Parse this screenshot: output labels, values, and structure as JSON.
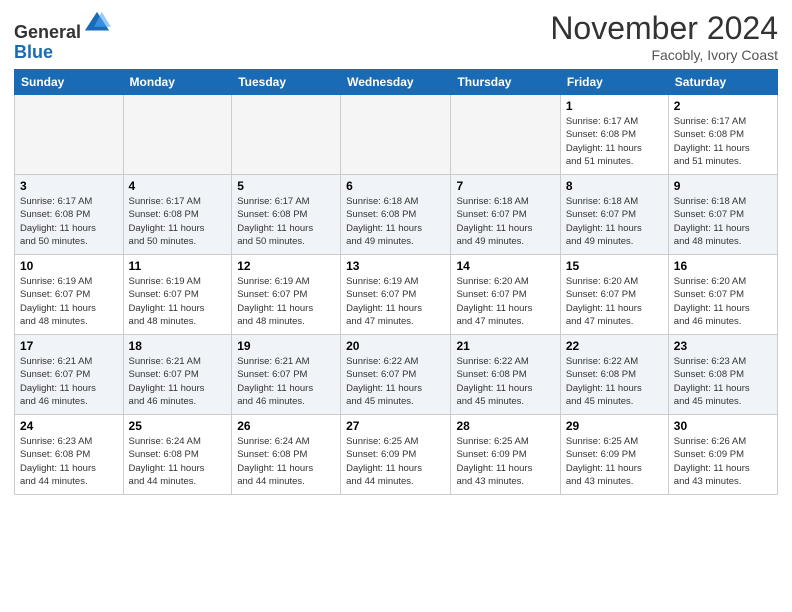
{
  "logo": {
    "general": "General",
    "blue": "Blue"
  },
  "header": {
    "month": "November 2024",
    "location": "Facobly, Ivory Coast"
  },
  "days_of_week": [
    "Sunday",
    "Monday",
    "Tuesday",
    "Wednesday",
    "Thursday",
    "Friday",
    "Saturday"
  ],
  "weeks": [
    [
      {
        "day": "",
        "info": ""
      },
      {
        "day": "",
        "info": ""
      },
      {
        "day": "",
        "info": ""
      },
      {
        "day": "",
        "info": ""
      },
      {
        "day": "",
        "info": ""
      },
      {
        "day": "1",
        "info": "Sunrise: 6:17 AM\nSunset: 6:08 PM\nDaylight: 11 hours\nand 51 minutes."
      },
      {
        "day": "2",
        "info": "Sunrise: 6:17 AM\nSunset: 6:08 PM\nDaylight: 11 hours\nand 51 minutes."
      }
    ],
    [
      {
        "day": "3",
        "info": "Sunrise: 6:17 AM\nSunset: 6:08 PM\nDaylight: 11 hours\nand 50 minutes."
      },
      {
        "day": "4",
        "info": "Sunrise: 6:17 AM\nSunset: 6:08 PM\nDaylight: 11 hours\nand 50 minutes."
      },
      {
        "day": "5",
        "info": "Sunrise: 6:17 AM\nSunset: 6:08 PM\nDaylight: 11 hours\nand 50 minutes."
      },
      {
        "day": "6",
        "info": "Sunrise: 6:18 AM\nSunset: 6:08 PM\nDaylight: 11 hours\nand 49 minutes."
      },
      {
        "day": "7",
        "info": "Sunrise: 6:18 AM\nSunset: 6:07 PM\nDaylight: 11 hours\nand 49 minutes."
      },
      {
        "day": "8",
        "info": "Sunrise: 6:18 AM\nSunset: 6:07 PM\nDaylight: 11 hours\nand 49 minutes."
      },
      {
        "day": "9",
        "info": "Sunrise: 6:18 AM\nSunset: 6:07 PM\nDaylight: 11 hours\nand 48 minutes."
      }
    ],
    [
      {
        "day": "10",
        "info": "Sunrise: 6:19 AM\nSunset: 6:07 PM\nDaylight: 11 hours\nand 48 minutes."
      },
      {
        "day": "11",
        "info": "Sunrise: 6:19 AM\nSunset: 6:07 PM\nDaylight: 11 hours\nand 48 minutes."
      },
      {
        "day": "12",
        "info": "Sunrise: 6:19 AM\nSunset: 6:07 PM\nDaylight: 11 hours\nand 48 minutes."
      },
      {
        "day": "13",
        "info": "Sunrise: 6:19 AM\nSunset: 6:07 PM\nDaylight: 11 hours\nand 47 minutes."
      },
      {
        "day": "14",
        "info": "Sunrise: 6:20 AM\nSunset: 6:07 PM\nDaylight: 11 hours\nand 47 minutes."
      },
      {
        "day": "15",
        "info": "Sunrise: 6:20 AM\nSunset: 6:07 PM\nDaylight: 11 hours\nand 47 minutes."
      },
      {
        "day": "16",
        "info": "Sunrise: 6:20 AM\nSunset: 6:07 PM\nDaylight: 11 hours\nand 46 minutes."
      }
    ],
    [
      {
        "day": "17",
        "info": "Sunrise: 6:21 AM\nSunset: 6:07 PM\nDaylight: 11 hours\nand 46 minutes."
      },
      {
        "day": "18",
        "info": "Sunrise: 6:21 AM\nSunset: 6:07 PM\nDaylight: 11 hours\nand 46 minutes."
      },
      {
        "day": "19",
        "info": "Sunrise: 6:21 AM\nSunset: 6:07 PM\nDaylight: 11 hours\nand 46 minutes."
      },
      {
        "day": "20",
        "info": "Sunrise: 6:22 AM\nSunset: 6:07 PM\nDaylight: 11 hours\nand 45 minutes."
      },
      {
        "day": "21",
        "info": "Sunrise: 6:22 AM\nSunset: 6:08 PM\nDaylight: 11 hours\nand 45 minutes."
      },
      {
        "day": "22",
        "info": "Sunrise: 6:22 AM\nSunset: 6:08 PM\nDaylight: 11 hours\nand 45 minutes."
      },
      {
        "day": "23",
        "info": "Sunrise: 6:23 AM\nSunset: 6:08 PM\nDaylight: 11 hours\nand 45 minutes."
      }
    ],
    [
      {
        "day": "24",
        "info": "Sunrise: 6:23 AM\nSunset: 6:08 PM\nDaylight: 11 hours\nand 44 minutes."
      },
      {
        "day": "25",
        "info": "Sunrise: 6:24 AM\nSunset: 6:08 PM\nDaylight: 11 hours\nand 44 minutes."
      },
      {
        "day": "26",
        "info": "Sunrise: 6:24 AM\nSunset: 6:08 PM\nDaylight: 11 hours\nand 44 minutes."
      },
      {
        "day": "27",
        "info": "Sunrise: 6:25 AM\nSunset: 6:09 PM\nDaylight: 11 hours\nand 44 minutes."
      },
      {
        "day": "28",
        "info": "Sunrise: 6:25 AM\nSunset: 6:09 PM\nDaylight: 11 hours\nand 43 minutes."
      },
      {
        "day": "29",
        "info": "Sunrise: 6:25 AM\nSunset: 6:09 PM\nDaylight: 11 hours\nand 43 minutes."
      },
      {
        "day": "30",
        "info": "Sunrise: 6:26 AM\nSunset: 6:09 PM\nDaylight: 11 hours\nand 43 minutes."
      }
    ]
  ]
}
